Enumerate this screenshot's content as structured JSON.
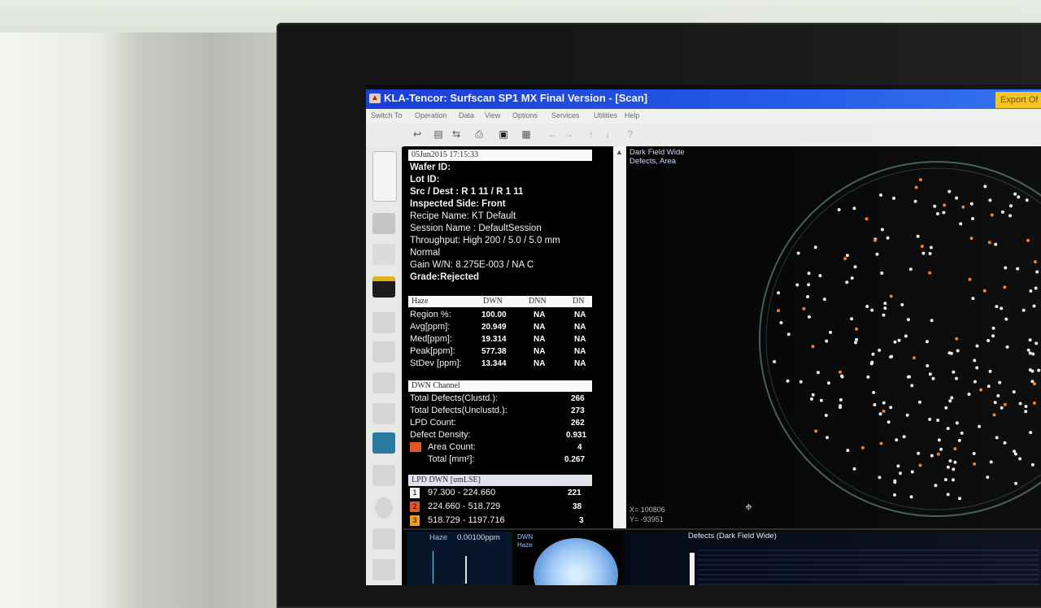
{
  "window": {
    "title": "KLA-Tencor:  Surfscan SP1 MX  Final Version - [Scan]",
    "badge": "Export Of"
  },
  "menu": [
    "Switch To",
    "Operation",
    "Data",
    "View",
    "Options",
    "Services",
    "Utilities",
    "Help"
  ],
  "toolbar": [
    "back-icon",
    "table-icon",
    "transfer-icon",
    "printer-icon",
    "save-icon",
    "print-icon",
    "nav-icon",
    "help-icon"
  ],
  "info": {
    "date": "05Jun2015  17:15:33",
    "wafer_id": "Wafer ID:",
    "lot_id": "Lot ID:",
    "src_dest": "Src / Dest :  R 1  11   /    R 1   11",
    "inspected_side": "Inspected Side: Front",
    "recipe": "Recipe Name:  KT Default",
    "session": "Session Name :  DefaultSession",
    "throughput": "Throughput:   High    200 / 5.0  /  5.0  mm",
    "mode": "Normal",
    "gain": "Gain W/N: 8.275E-003 / NA C",
    "grade": "Grade:Rejected"
  },
  "haze": {
    "headers": [
      "Haze",
      "DWN",
      "DNN",
      "DN"
    ],
    "rows": [
      {
        "label": "Region %:",
        "dwn": "100.00",
        "dnn": "NA",
        "dn": "NA"
      },
      {
        "label": "Avg[ppm]:",
        "dwn": "20.949",
        "dnn": "NA",
        "dn": "NA"
      },
      {
        "label": "Med[ppm]:",
        "dwn": "19.314",
        "dnn": "NA",
        "dn": "NA"
      },
      {
        "label": "Peak[ppm]:",
        "dwn": "577.38",
        "dnn": "NA",
        "dn": "NA"
      },
      {
        "label": "StDev [ppm]:",
        "dwn": "13.344",
        "dnn": "NA",
        "dn": "NA"
      }
    ]
  },
  "channel": {
    "header": "DWN  Channel",
    "rows": [
      {
        "label": "Total Defects(Clustd.):",
        "value": "266"
      },
      {
        "label": "Total Defects(Unclustd.):",
        "value": "273"
      },
      {
        "label": "LPD Count:",
        "value": "262"
      },
      {
        "label": "Defect Density:",
        "value": "0.931"
      },
      {
        "label": "Area Count:",
        "value": "4"
      },
      {
        "label": "Total [mm²]:",
        "value": "0.267"
      }
    ],
    "area_color": "#e2562a"
  },
  "lpd": {
    "header": "LPD DWN  [umLSE]",
    "rows": [
      {
        "index": "1",
        "range": "97.300  -  224.660",
        "count": "221",
        "color": "#f0f0f0"
      },
      {
        "index": "2",
        "range": "224.660  -  518.729",
        "count": "38",
        "color": "#e2562a"
      },
      {
        "index": "3",
        "range": "518.729  -  1197.716",
        "count": "3",
        "color": "#f0a020"
      }
    ]
  },
  "map": {
    "caption1": "Dark Field Wide",
    "caption2": "Defects, Area",
    "x_readout": "X= 100806",
    "y_readout": "Y= -93951",
    "point_color": "#e8e8e8",
    "hot_color": "#f07a2a",
    "ring_color": "#3f5a5e"
  },
  "bottom": {
    "haze_label": "Haze",
    "haze_value": "0.00100ppm",
    "dwn_label": "DWN",
    "dwn_sub": "Haze",
    "defects_label": "Defects (Dark Field Wide)"
  }
}
